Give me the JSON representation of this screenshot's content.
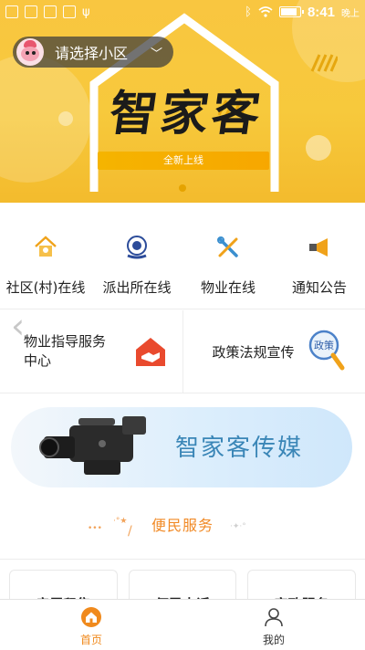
{
  "status_bar": {
    "time": "8:41",
    "ampm": "晚上",
    "battery_level": 0.9,
    "icons": [
      "notification-icon",
      "check-icon",
      "phone-icon",
      "sim-icon",
      "usb-icon",
      "bluetooth-icon",
      "wifi-icon",
      "battery-icon"
    ]
  },
  "banner": {
    "community_selector": {
      "label": "请选择小区",
      "icon": "chevron-down-icon"
    },
    "logo_text": "智家客",
    "tagline": "全新上线",
    "colors": {
      "background": "#f7c93c",
      "tagline": "#f5b400"
    }
  },
  "quick_services": [
    {
      "label": "社区(村)在线",
      "icon": "house-icon",
      "color": "#f0a21a"
    },
    {
      "label": "派出所在线",
      "icon": "police-badge-icon",
      "color": "#2c4c9a"
    },
    {
      "label": "物业在线",
      "icon": "tools-icon",
      "color": "#3b8fcf"
    },
    {
      "label": "通知公告",
      "icon": "megaphone-icon",
      "color": "#f0a21a"
    }
  ],
  "features": [
    {
      "label_line1": "物业指导服务",
      "label_line2": "中心",
      "icon": "handshake-house-icon"
    },
    {
      "label": "政策法规宣传",
      "icon": "policy-magnifier-icon",
      "icon_text": "政策"
    }
  ],
  "media": {
    "title": "智家客传媒",
    "icon": "video-camera-icon"
  },
  "section": {
    "title": "便民服务"
  },
  "service_cards": [
    {
      "label": "房屋租售"
    },
    {
      "label": "便民电话"
    },
    {
      "label": "家政服务"
    }
  ],
  "tab_bar": {
    "tabs": [
      {
        "label": "首页",
        "icon": "home-icon",
        "active": true
      },
      {
        "label": "我的",
        "icon": "user-icon",
        "active": false
      }
    ],
    "accent": "#f08a1d"
  }
}
